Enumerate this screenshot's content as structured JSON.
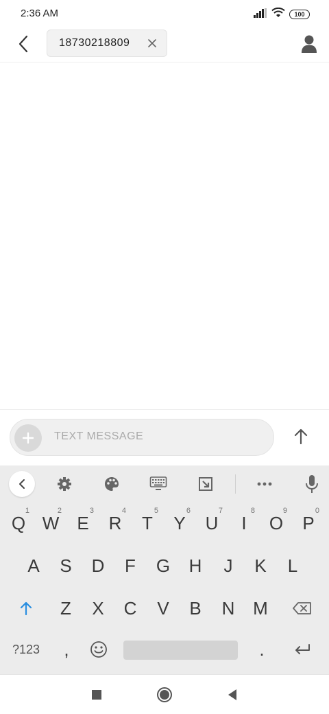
{
  "status_bar": {
    "time": "2:36  AM",
    "battery": "100",
    "icons": [
      "signal-icon",
      "wifi-icon",
      "battery-icon"
    ]
  },
  "header": {
    "recipient": "18730218809",
    "icons": [
      "back-arrow-icon",
      "close-icon",
      "contact-icon"
    ]
  },
  "composer": {
    "placeholder": "TEXT MESSAGE",
    "icons": [
      "plus-icon",
      "send-arrow-icon"
    ]
  },
  "keyboard": {
    "toolbar": [
      "chevron-left-icon",
      "gear-icon",
      "palette-icon",
      "keyboard-icon",
      "resize-icon",
      "more-icon",
      "microphone-icon"
    ],
    "row1": [
      {
        "label": "Q",
        "hint": "1"
      },
      {
        "label": "W",
        "hint": "2"
      },
      {
        "label": "E",
        "hint": "3"
      },
      {
        "label": "R",
        "hint": "4"
      },
      {
        "label": "T",
        "hint": "5"
      },
      {
        "label": "Y",
        "hint": "6"
      },
      {
        "label": "U",
        "hint": "7"
      },
      {
        "label": "I",
        "hint": "8"
      },
      {
        "label": "O",
        "hint": "9"
      },
      {
        "label": "P",
        "hint": "0"
      }
    ],
    "row2": [
      "A",
      "S",
      "D",
      "F",
      "G",
      "H",
      "J",
      "K",
      "L"
    ],
    "row3": [
      "Z",
      "X",
      "C",
      "V",
      "B",
      "N",
      "M"
    ],
    "row4": {
      "symbols": "?123",
      "comma": ",",
      "period": "."
    }
  },
  "colors": {
    "accent": "#2a8ee0",
    "keyboard_bg": "#ececec",
    "key_text": "#3a3a3a"
  }
}
